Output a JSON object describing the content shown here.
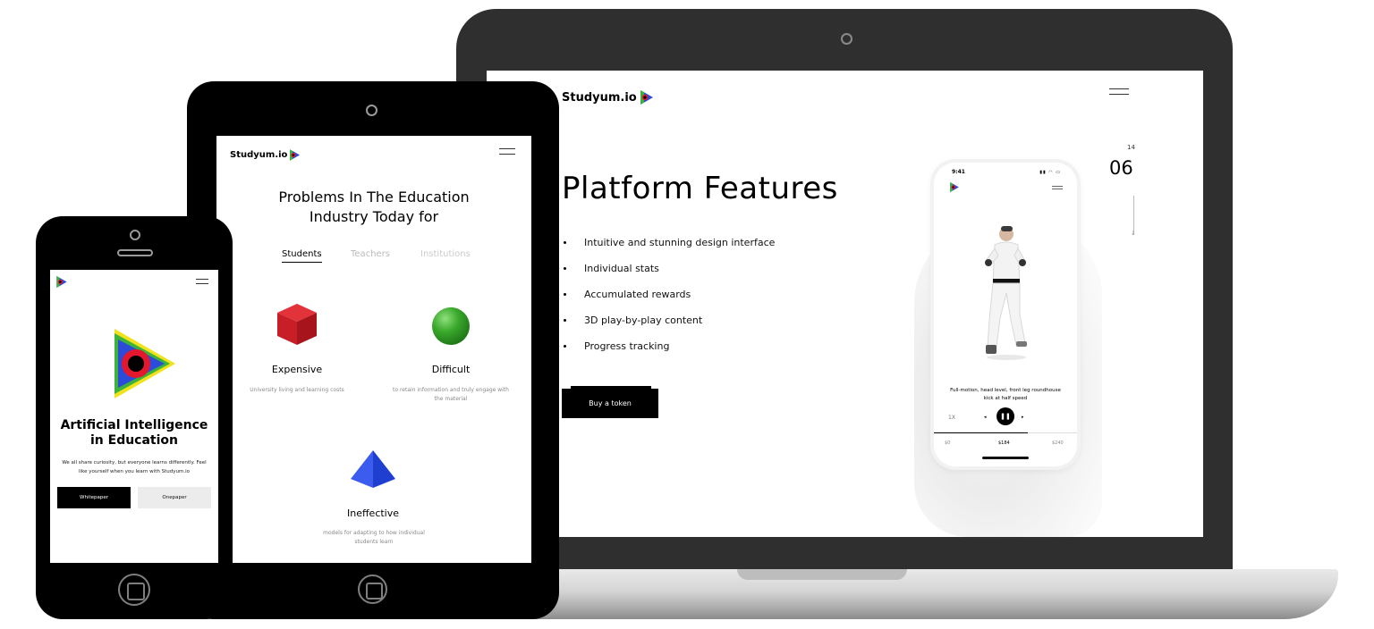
{
  "laptop": {
    "brand": "Studyum.io",
    "title": "Platform Features",
    "features": [
      "Intuitive and stunning design interface",
      "Individual stats",
      "Accumulated rewards",
      "3D play-by-play content",
      "Progress tracking"
    ],
    "cta": "Buy a token",
    "slide_total": "14",
    "slide_current": "06",
    "app_mock": {
      "time": "9:41",
      "caption": "Full-motion, head level, front leg roundhouse kick at half speed",
      "rewind_label": "1X",
      "prices": [
        "$0",
        "$184",
        "$240"
      ]
    }
  },
  "tablet": {
    "brand": "Studyum.io",
    "title": "Problems In The Education Industry Today for",
    "tabs": [
      "Students",
      "Teachers",
      "Institutions"
    ],
    "active_tab": "Students",
    "cards": [
      {
        "title": "Expensive",
        "desc": "University living and learning costs",
        "icon": "red-cube-icon"
      },
      {
        "title": "Difficult",
        "desc": "to retain information and truly engage with the material",
        "icon": "green-sphere-icon"
      },
      {
        "title": "Ineffective",
        "desc": "models for adapting to how individual students learn",
        "icon": "blue-pyramid-icon"
      }
    ]
  },
  "phone": {
    "title": "Artificial Intelligence in Education",
    "subtitle": "We all share curiosity, but everyone learns differently. Feel like yourself when you learn with Studyum.io",
    "buttons": [
      "Whitepaper",
      "Onepaper"
    ]
  },
  "colors": {
    "brand_red": "#e3172d",
    "brand_blue": "#2b4bd8",
    "brand_green": "#3cb43c",
    "brand_yellow": "#f2e21b",
    "dark": "#000000"
  }
}
